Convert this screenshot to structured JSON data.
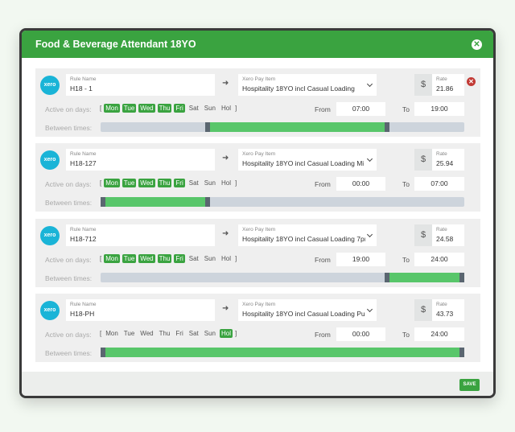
{
  "modal": {
    "title": "Food & Beverage Attendant 18YO",
    "close_glyph": "✕",
    "save_label": "SAVE"
  },
  "labels": {
    "rule_name": "Rule Name",
    "pay_item": "Xero Pay Item",
    "rate": "Rate",
    "active_on_days": "Active on days:",
    "between_times": "Between times:",
    "from": "From",
    "to": "To",
    "currency": "$",
    "xero": "xero",
    "bracket_open": "[",
    "bracket_close": "]"
  },
  "accent_color": "#3aa340",
  "rules": [
    {
      "name": "H18 - 1",
      "pay_item": "Hospitality 18YO incl Casual Loading",
      "rate": "21.86",
      "days": [
        {
          "label": "Mon",
          "on": true
        },
        {
          "label": "Tue",
          "on": true
        },
        {
          "label": "Wed",
          "on": true
        },
        {
          "label": "Thu",
          "on": true
        },
        {
          "label": "Fri",
          "on": true
        },
        {
          "label": "Sat",
          "on": false
        },
        {
          "label": "Sun",
          "on": false
        },
        {
          "label": "Hol",
          "on": false
        }
      ],
      "from": "07:00",
      "to": "19:00",
      "range_fraction": [
        0.2917,
        0.7917
      ],
      "removable": true
    },
    {
      "name": "H18-127",
      "pay_item": "Hospitality 18YO incl Casual Loading Mi",
      "rate": "25.94",
      "days": [
        {
          "label": "Mon",
          "on": true
        },
        {
          "label": "Tue",
          "on": true
        },
        {
          "label": "Wed",
          "on": true
        },
        {
          "label": "Thu",
          "on": true
        },
        {
          "label": "Fri",
          "on": true
        },
        {
          "label": "Sat",
          "on": false
        },
        {
          "label": "Sun",
          "on": false
        },
        {
          "label": "Hol",
          "on": false
        }
      ],
      "from": "00:00",
      "to": "07:00",
      "range_fraction": [
        0.0,
        0.2917
      ],
      "removable": false
    },
    {
      "name": "H18-712",
      "pay_item": "Hospitality 18YO incl Casual Loading 7pı",
      "rate": "24.58",
      "days": [
        {
          "label": "Mon",
          "on": true
        },
        {
          "label": "Tue",
          "on": true
        },
        {
          "label": "Wed",
          "on": true
        },
        {
          "label": "Thu",
          "on": true
        },
        {
          "label": "Fri",
          "on": true
        },
        {
          "label": "Sat",
          "on": false
        },
        {
          "label": "Sun",
          "on": false
        },
        {
          "label": "Hol",
          "on": false
        }
      ],
      "from": "19:00",
      "to": "24:00",
      "range_fraction": [
        0.7917,
        1.0
      ],
      "removable": false
    },
    {
      "name": "H18-PH",
      "pay_item": "Hospitality 18YO incl Casual Loading Pul",
      "rate": "43.73",
      "days": [
        {
          "label": "Mon",
          "on": false
        },
        {
          "label": "Tue",
          "on": false
        },
        {
          "label": "Wed",
          "on": false
        },
        {
          "label": "Thu",
          "on": false
        },
        {
          "label": "Fri",
          "on": false
        },
        {
          "label": "Sat",
          "on": false
        },
        {
          "label": "Sun",
          "on": false
        },
        {
          "label": "Hol",
          "on": true
        }
      ],
      "from": "00:00",
      "to": "24:00",
      "range_fraction": [
        0.0,
        1.0
      ],
      "removable": false
    }
  ]
}
